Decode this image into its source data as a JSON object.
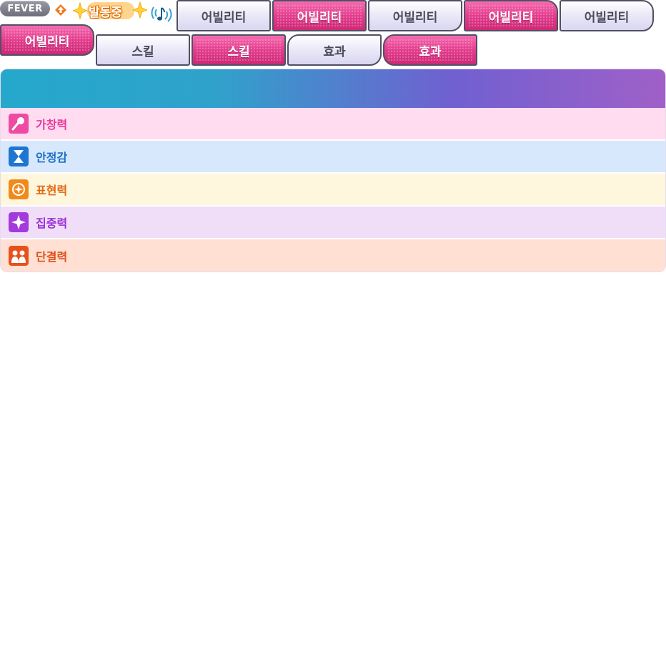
{
  "status": {
    "fever_label": "FEVER",
    "active_label": "발동중"
  },
  "tabs_row1": [
    {
      "label": "어빌리티",
      "state": "off"
    },
    {
      "label": "어빌리티",
      "state": "on"
    },
    {
      "label": "어빌리티",
      "state": "off"
    },
    {
      "label": "어빌리티",
      "state": "on"
    },
    {
      "label": "어빌리티",
      "state": "off"
    }
  ],
  "tabs_row2": [
    {
      "label": "어빌리티",
      "state": "on"
    },
    {
      "label": "스킬",
      "state": "off"
    },
    {
      "label": "스킬",
      "state": "on"
    },
    {
      "label": "효과",
      "state": "off"
    },
    {
      "label": "효과",
      "state": "on"
    }
  ],
  "attributes": [
    {
      "label": "가창력",
      "icon": "microphone-icon",
      "color": "#e8399a",
      "bg": "#ffdcf0"
    },
    {
      "label": "안정감",
      "icon": "hourglass-icon",
      "color": "#1a6ec8",
      "bg": "#d8e8fc"
    },
    {
      "label": "표현력",
      "icon": "compass-icon",
      "color": "#e06a10",
      "bg": "#fff6de"
    },
    {
      "label": "집중력",
      "icon": "sparkle-icon",
      "color": "#9b30d8",
      "bg": "#f0def8"
    },
    {
      "label": "단결력",
      "icon": "team-icon",
      "color": "#e0501a",
      "bg": "#ffe0d2"
    }
  ]
}
